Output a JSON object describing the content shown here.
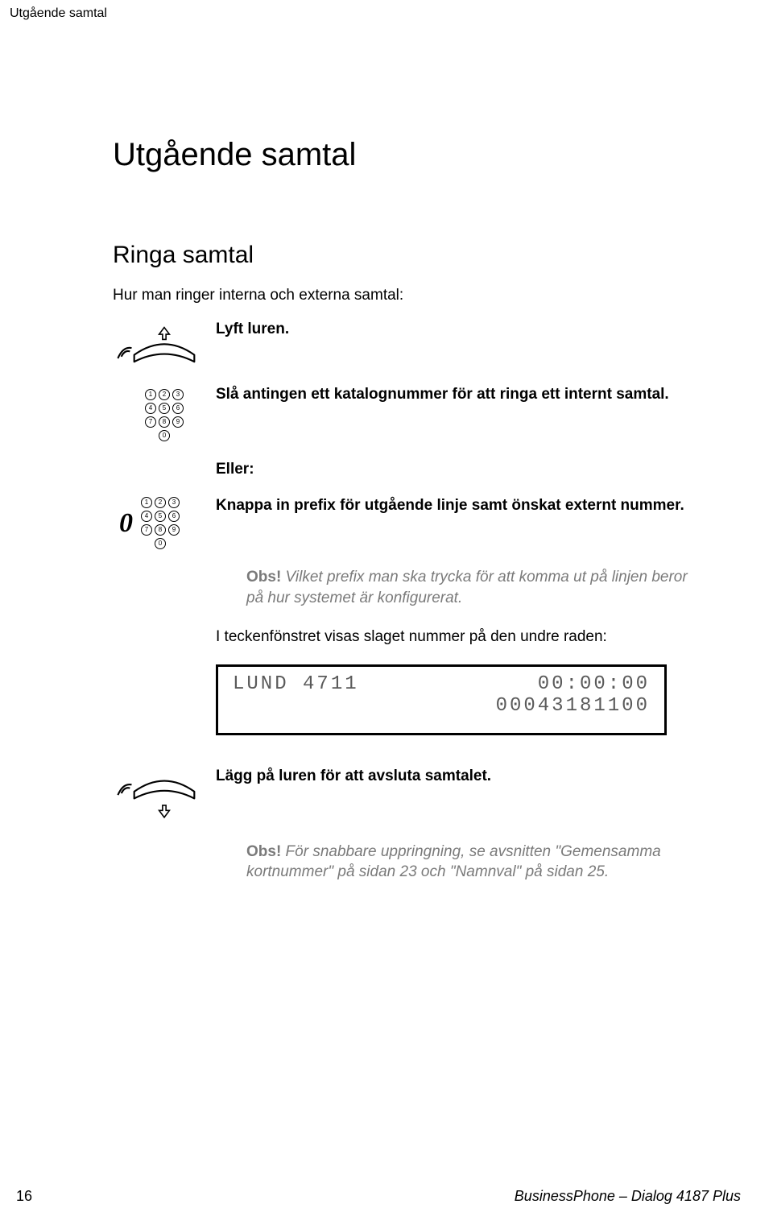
{
  "header": "Utgående samtal",
  "title": "Utgående samtal",
  "subtitle": "Ringa samtal",
  "intro": "Hur man ringer interna och externa samtal:",
  "step_lift": "Lyft luren.",
  "step_dial_internal": "Slå antingen ett katalognummer för att ringa ett internt samtal.",
  "eller": "Eller:",
  "step_dial_external": "Knappa in prefix för utgående linje samt önskat externt nummer.",
  "note1_label": "Obs!",
  "note1_text": " Vilket prefix man ska trycka för att komma ut på linjen beror på hur systemet är konfigurerat.",
  "display_intro": "I teckenfönstret visas slaget nummer på den undre raden:",
  "display": {
    "left": "LUND 4711",
    "right": "00:00:00",
    "line2": "00043181100"
  },
  "step_hangup": "Lägg på luren för att avsluta samtalet.",
  "note2_label": "Obs!",
  "note2_pre": " För snabbare uppringning, se avsnitten \"",
  "note2_link1": "Gemensamma kortnummer",
  "note2_mid": "\" på sidan 23 och \"",
  "note2_link2": "Namnval",
  "note2_post": "\" på sidan 25.",
  "prefix_digit": "0",
  "footer": {
    "page": "16",
    "product": "BusinessPhone – Dialog 4187 Plus"
  }
}
